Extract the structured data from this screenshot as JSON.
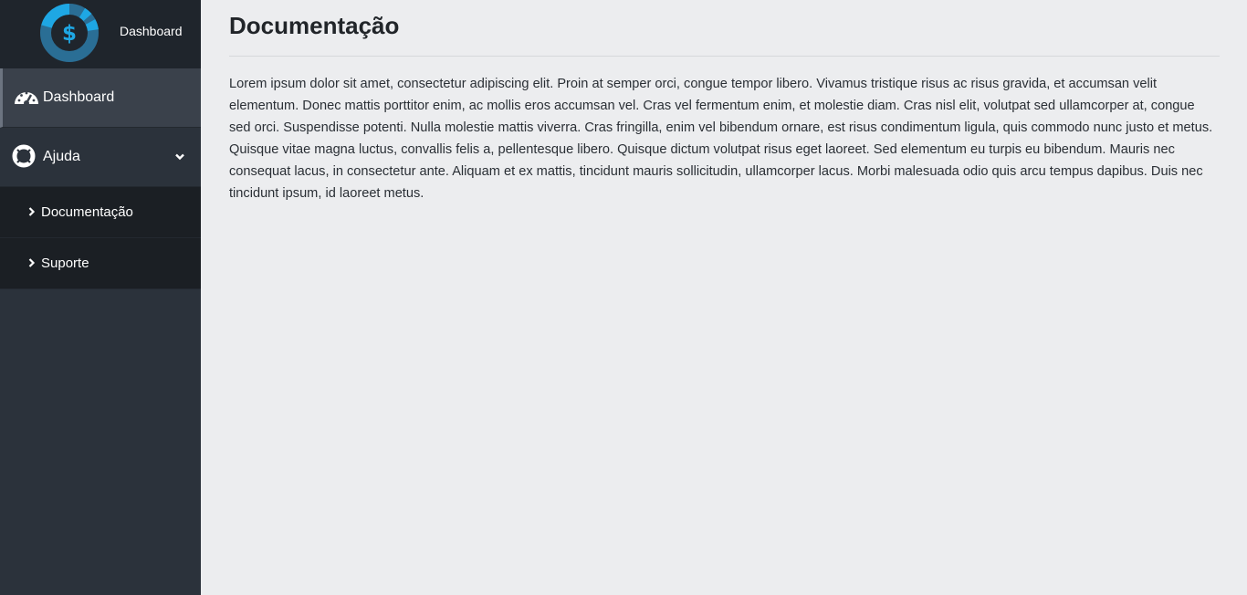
{
  "brand": {
    "label": "Dashboard",
    "logo_icon": "dollar-gauge-icon",
    "accent": "#1ea7e4"
  },
  "sidebar": {
    "items": [
      {
        "label": "Dashboard",
        "icon": "tachometer-icon",
        "active": true
      },
      {
        "label": "Ajuda",
        "icon": "life-ring-icon",
        "expanded": true,
        "children": [
          {
            "label": "Documentação",
            "icon": "chevron-right-icon"
          },
          {
            "label": "Suporte",
            "icon": "chevron-right-icon"
          }
        ]
      }
    ]
  },
  "main": {
    "title": "Documentação",
    "body": "Lorem ipsum dolor sit amet, consectetur adipiscing elit. Proin at semper orci, congue tempor libero. Vivamus tristique risus ac risus gravida, et accumsan velit elementum. Donec mattis porttitor enim, ac mollis eros accumsan vel. Cras vel fermentum enim, et molestie diam. Cras nisl elit, volutpat sed ullamcorper at, congue sed orci. Suspendisse potenti. Nulla molestie mattis viverra. Cras fringilla, enim vel bibendum ornare, est risus condimentum ligula, quis commodo nunc justo et metus. Quisque vitae magna luctus, convallis felis a, pellentesque libero. Quisque dictum volutpat risus eget laoreet. Sed elementum eu turpis eu bibendum. Mauris nec consequat lacus, in consectetur ante. Aliquam et ex mattis, tincidunt mauris sollicitudin, ullamcorper lacus. Morbi malesuada odio quis arcu tempus dapibus. Duis nec tincidunt ipsum, id laoreet metus."
  }
}
